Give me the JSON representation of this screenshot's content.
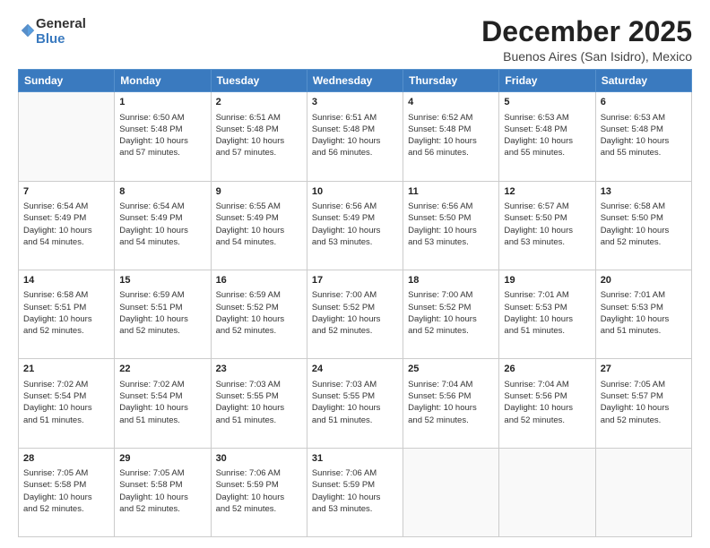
{
  "header": {
    "logo_line1": "General",
    "logo_line2": "Blue",
    "month": "December 2025",
    "location": "Buenos Aires (San Isidro), Mexico"
  },
  "weekdays": [
    "Sunday",
    "Monday",
    "Tuesday",
    "Wednesday",
    "Thursday",
    "Friday",
    "Saturday"
  ],
  "weeks": [
    [
      {
        "day": "",
        "info": ""
      },
      {
        "day": "1",
        "info": "Sunrise: 6:50 AM\nSunset: 5:48 PM\nDaylight: 10 hours\nand 57 minutes."
      },
      {
        "day": "2",
        "info": "Sunrise: 6:51 AM\nSunset: 5:48 PM\nDaylight: 10 hours\nand 57 minutes."
      },
      {
        "day": "3",
        "info": "Sunrise: 6:51 AM\nSunset: 5:48 PM\nDaylight: 10 hours\nand 56 minutes."
      },
      {
        "day": "4",
        "info": "Sunrise: 6:52 AM\nSunset: 5:48 PM\nDaylight: 10 hours\nand 56 minutes."
      },
      {
        "day": "5",
        "info": "Sunrise: 6:53 AM\nSunset: 5:48 PM\nDaylight: 10 hours\nand 55 minutes."
      },
      {
        "day": "6",
        "info": "Sunrise: 6:53 AM\nSunset: 5:48 PM\nDaylight: 10 hours\nand 55 minutes."
      }
    ],
    [
      {
        "day": "7",
        "info": "Sunrise: 6:54 AM\nSunset: 5:49 PM\nDaylight: 10 hours\nand 54 minutes."
      },
      {
        "day": "8",
        "info": "Sunrise: 6:54 AM\nSunset: 5:49 PM\nDaylight: 10 hours\nand 54 minutes."
      },
      {
        "day": "9",
        "info": "Sunrise: 6:55 AM\nSunset: 5:49 PM\nDaylight: 10 hours\nand 54 minutes."
      },
      {
        "day": "10",
        "info": "Sunrise: 6:56 AM\nSunset: 5:49 PM\nDaylight: 10 hours\nand 53 minutes."
      },
      {
        "day": "11",
        "info": "Sunrise: 6:56 AM\nSunset: 5:50 PM\nDaylight: 10 hours\nand 53 minutes."
      },
      {
        "day": "12",
        "info": "Sunrise: 6:57 AM\nSunset: 5:50 PM\nDaylight: 10 hours\nand 53 minutes."
      },
      {
        "day": "13",
        "info": "Sunrise: 6:58 AM\nSunset: 5:50 PM\nDaylight: 10 hours\nand 52 minutes."
      }
    ],
    [
      {
        "day": "14",
        "info": "Sunrise: 6:58 AM\nSunset: 5:51 PM\nDaylight: 10 hours\nand 52 minutes."
      },
      {
        "day": "15",
        "info": "Sunrise: 6:59 AM\nSunset: 5:51 PM\nDaylight: 10 hours\nand 52 minutes."
      },
      {
        "day": "16",
        "info": "Sunrise: 6:59 AM\nSunset: 5:52 PM\nDaylight: 10 hours\nand 52 minutes."
      },
      {
        "day": "17",
        "info": "Sunrise: 7:00 AM\nSunset: 5:52 PM\nDaylight: 10 hours\nand 52 minutes."
      },
      {
        "day": "18",
        "info": "Sunrise: 7:00 AM\nSunset: 5:52 PM\nDaylight: 10 hours\nand 52 minutes."
      },
      {
        "day": "19",
        "info": "Sunrise: 7:01 AM\nSunset: 5:53 PM\nDaylight: 10 hours\nand 51 minutes."
      },
      {
        "day": "20",
        "info": "Sunrise: 7:01 AM\nSunset: 5:53 PM\nDaylight: 10 hours\nand 51 minutes."
      }
    ],
    [
      {
        "day": "21",
        "info": "Sunrise: 7:02 AM\nSunset: 5:54 PM\nDaylight: 10 hours\nand 51 minutes."
      },
      {
        "day": "22",
        "info": "Sunrise: 7:02 AM\nSunset: 5:54 PM\nDaylight: 10 hours\nand 51 minutes."
      },
      {
        "day": "23",
        "info": "Sunrise: 7:03 AM\nSunset: 5:55 PM\nDaylight: 10 hours\nand 51 minutes."
      },
      {
        "day": "24",
        "info": "Sunrise: 7:03 AM\nSunset: 5:55 PM\nDaylight: 10 hours\nand 51 minutes."
      },
      {
        "day": "25",
        "info": "Sunrise: 7:04 AM\nSunset: 5:56 PM\nDaylight: 10 hours\nand 52 minutes."
      },
      {
        "day": "26",
        "info": "Sunrise: 7:04 AM\nSunset: 5:56 PM\nDaylight: 10 hours\nand 52 minutes."
      },
      {
        "day": "27",
        "info": "Sunrise: 7:05 AM\nSunset: 5:57 PM\nDaylight: 10 hours\nand 52 minutes."
      }
    ],
    [
      {
        "day": "28",
        "info": "Sunrise: 7:05 AM\nSunset: 5:58 PM\nDaylight: 10 hours\nand 52 minutes."
      },
      {
        "day": "29",
        "info": "Sunrise: 7:05 AM\nSunset: 5:58 PM\nDaylight: 10 hours\nand 52 minutes."
      },
      {
        "day": "30",
        "info": "Sunrise: 7:06 AM\nSunset: 5:59 PM\nDaylight: 10 hours\nand 52 minutes."
      },
      {
        "day": "31",
        "info": "Sunrise: 7:06 AM\nSunset: 5:59 PM\nDaylight: 10 hours\nand 53 minutes."
      },
      {
        "day": "",
        "info": ""
      },
      {
        "day": "",
        "info": ""
      },
      {
        "day": "",
        "info": ""
      }
    ]
  ]
}
